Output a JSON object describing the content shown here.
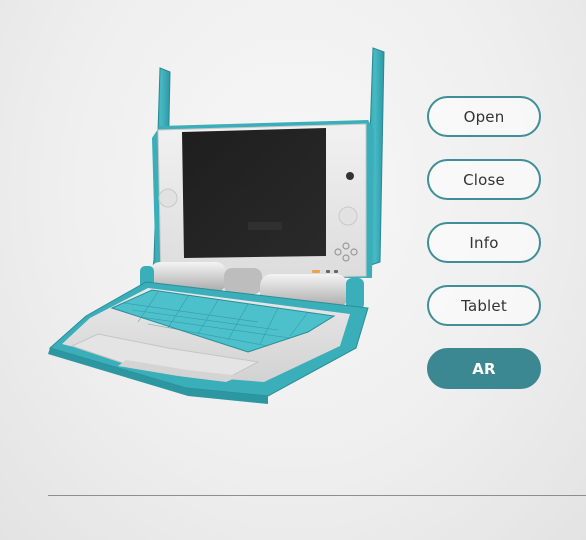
{
  "viewer": {
    "model_name": "laptop-model"
  },
  "controls": {
    "buttons": [
      {
        "id": "open",
        "label": "Open",
        "active": false
      },
      {
        "id": "close",
        "label": "Close",
        "active": false
      },
      {
        "id": "info",
        "label": "Info",
        "active": false
      },
      {
        "id": "tablet",
        "label": "Tablet",
        "active": false
      },
      {
        "id": "ar",
        "label": "AR",
        "active": true
      }
    ]
  },
  "colors": {
    "accent": "#3b8792",
    "laptop_teal": "#3fb3be",
    "laptop_white": "#e6e6e6",
    "screen": "#1b1b1b"
  }
}
